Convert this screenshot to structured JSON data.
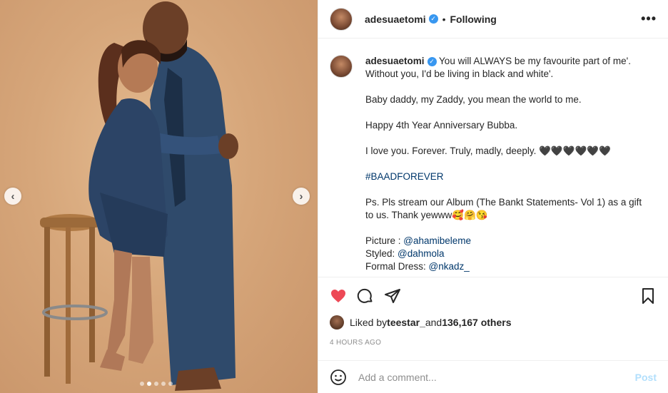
{
  "post": {
    "username": "adesuaetomi",
    "follow_state": "Following",
    "separator": "•",
    "more_icon": "more-horizontal-icon"
  },
  "media": {
    "prev_glyph": "‹",
    "next_glyph": "›",
    "carousel_count": 5,
    "carousel_active": 2
  },
  "caption": {
    "username": "adesuaetomi",
    "line1": "You will ALWAYS be my favourite part of me'. Without you, I'd be living in black and white'.",
    "line2": "Baby daddy, my Zaddy, you mean the world to me.",
    "line3": "Happy 4th Year Anniversary Bubba.",
    "line4": "I love you. Forever. Truly, madly, deeply. 🖤🖤🖤🖤🖤🖤",
    "hashtag": "#BAADFOREVER",
    "line5": "Ps. Pls stream our Album (The Bankt Statements- Vol 1) as a gift to us. Thank yewww🥰🤗😘",
    "credit1_label": "Picture : ",
    "credit1_value": "@ahamibeleme",
    "credit2_label": "Styled: ",
    "credit2_value": "@dahmola",
    "credit3_label": "Formal Dress: ",
    "credit3_value": "@nkadz_"
  },
  "likes": {
    "prefix": "Liked by ",
    "user": "teestar_",
    "middle": " and ",
    "count": "136,167 others"
  },
  "timestamp": "4 HOURS AGO",
  "comment": {
    "placeholder": "Add a comment...",
    "post_label": "Post"
  },
  "colors": {
    "like_red": "#ed4956",
    "link_blue": "#00376b",
    "verified_blue": "#3897f0",
    "post_disabled": "#b2dffc"
  }
}
